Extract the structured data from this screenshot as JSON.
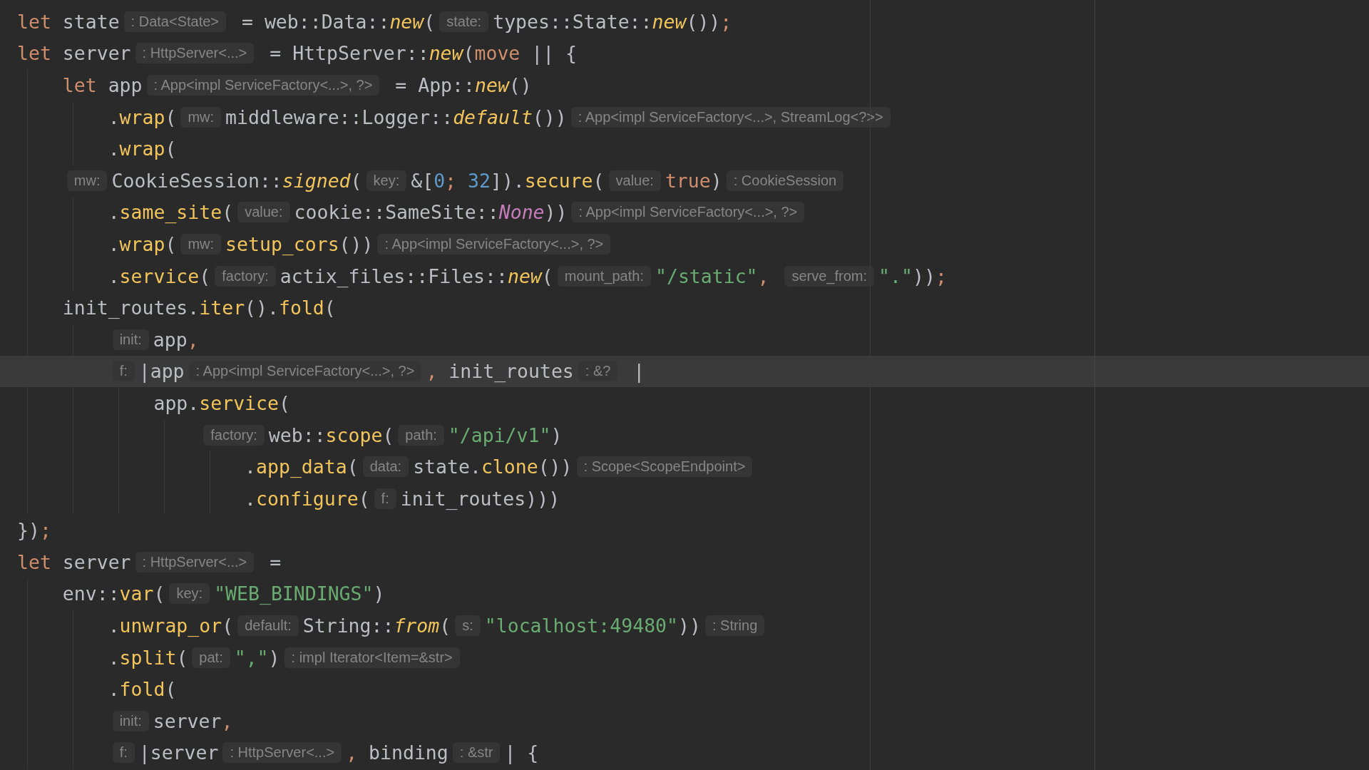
{
  "lines": [
    {
      "current": false,
      "tokens": [
        {
          "kind": "kw",
          "text": "let"
        },
        {
          "kind": "id",
          "text": " state"
        },
        {
          "kind": "hint",
          "text": ": Data<State>"
        },
        {
          "kind": "id",
          "text": " = web::Data::"
        },
        {
          "kind": "fni",
          "text": "new"
        },
        {
          "kind": "id",
          "text": "("
        },
        {
          "kind": "hint",
          "text": "state:"
        },
        {
          "kind": "id",
          "text": "types::State::"
        },
        {
          "kind": "fni",
          "text": "new"
        },
        {
          "kind": "id",
          "text": "())"
        },
        {
          "kind": "op",
          "text": ";"
        }
      ]
    },
    {
      "current": false,
      "tokens": [
        {
          "kind": "kw",
          "text": "let"
        },
        {
          "kind": "id",
          "text": " server"
        },
        {
          "kind": "hint",
          "text": ": HttpServer<...>"
        },
        {
          "kind": "id",
          "text": " = HttpServer::"
        },
        {
          "kind": "fni",
          "text": "new"
        },
        {
          "kind": "id",
          "text": "("
        },
        {
          "kind": "kw",
          "text": "move"
        },
        {
          "kind": "id",
          "text": " || {"
        }
      ],
      "children": [
        {
          "current": false,
          "tokens": [
            {
              "kind": "kw",
              "text": "let"
            },
            {
              "kind": "id",
              "text": " app"
            },
            {
              "kind": "hint",
              "text": ": App<impl ServiceFactory<...>, ?>"
            },
            {
              "kind": "id",
              "text": " = App::"
            },
            {
              "kind": "fni",
              "text": "new"
            },
            {
              "kind": "id",
              "text": "()"
            }
          ],
          "children": [
            {
              "current": false,
              "tokens": [
                {
                  "kind": "method",
                  "text": ".wrap"
                },
                {
                  "kind": "id",
                  "text": "("
                },
                {
                  "kind": "hint",
                  "text": "mw:"
                },
                {
                  "kind": "id",
                  "text": "middleware::Logger::"
                },
                {
                  "kind": "fni",
                  "text": "default"
                },
                {
                  "kind": "id",
                  "text": "())"
                },
                {
                  "kind": "hint",
                  "text": ": App<impl ServiceFactory<...>, StreamLog<?>>"
                }
              ]
            },
            {
              "current": false,
              "tokens": [
                {
                  "kind": "method",
                  "text": ".wrap"
                },
                {
                  "kind": "id",
                  "text": "("
                }
              ]
            }
          ]
        },
        {
          "current": false,
          "tokens": [
            {
              "kind": "hint",
              "text": "mw:"
            },
            {
              "kind": "id",
              "text": "CookieSession::"
            },
            {
              "kind": "fni",
              "text": "signed"
            },
            {
              "kind": "id",
              "text": "("
            },
            {
              "kind": "hint",
              "text": "key:"
            },
            {
              "kind": "id",
              "text": "&["
            },
            {
              "kind": "num",
              "text": "0"
            },
            {
              "kind": "op",
              "text": ";"
            },
            {
              "kind": "num",
              "text": " 32"
            },
            {
              "kind": "id",
              "text": "])"
            },
            {
              "kind": "method",
              "text": ".secure"
            },
            {
              "kind": "id",
              "text": "("
            },
            {
              "kind": "hint",
              "text": "value:"
            },
            {
              "kind": "kw",
              "text": "true"
            },
            {
              "kind": "id",
              "text": ")"
            },
            {
              "kind": "hint",
              "text": ": CookieSession"
            }
          ],
          "children": [
            {
              "current": false,
              "tokens": [
                {
                  "kind": "method",
                  "text": ".same_site"
                },
                {
                  "kind": "id",
                  "text": "("
                },
                {
                  "kind": "hint",
                  "text": "value:"
                },
                {
                  "kind": "id",
                  "text": "cookie::SameSite::"
                },
                {
                  "kind": "enum",
                  "text": "None"
                },
                {
                  "kind": "id",
                  "text": "))"
                },
                {
                  "kind": "hint",
                  "text": ": App<impl ServiceFactory<...>, ?>"
                }
              ]
            },
            {
              "current": false,
              "tokens": [
                {
                  "kind": "method",
                  "text": ".wrap"
                },
                {
                  "kind": "id",
                  "text": "("
                },
                {
                  "kind": "hint",
                  "text": "mw:"
                },
                {
                  "kind": "fn",
                  "text": "setup_cors"
                },
                {
                  "kind": "id",
                  "text": "())"
                },
                {
                  "kind": "hint",
                  "text": ": App<impl ServiceFactory<...>, ?>"
                }
              ]
            },
            {
              "current": false,
              "tokens": [
                {
                  "kind": "method",
                  "text": ".service"
                },
                {
                  "kind": "id",
                  "text": "("
                },
                {
                  "kind": "hint",
                  "text": "factory:"
                },
                {
                  "kind": "id",
                  "text": "actix_files::Files::"
                },
                {
                  "kind": "fni",
                  "text": "new"
                },
                {
                  "kind": "id",
                  "text": "("
                },
                {
                  "kind": "hint",
                  "text": "mount_path:"
                },
                {
                  "kind": "str",
                  "text": "\"/static\""
                },
                {
                  "kind": "op",
                  "text": ", "
                },
                {
                  "kind": "hint",
                  "text": "serve_from:"
                },
                {
                  "kind": "str",
                  "text": "\".\""
                },
                {
                  "kind": "id",
                  "text": "))"
                },
                {
                  "kind": "op",
                  "text": ";"
                }
              ]
            }
          ]
        },
        {
          "current": false,
          "tokens": [
            {
              "kind": "id",
              "text": "init_routes"
            },
            {
              "kind": "method",
              "text": ".iter"
            },
            {
              "kind": "id",
              "text": "()"
            },
            {
              "kind": "method",
              "text": ".fold"
            },
            {
              "kind": "id",
              "text": "("
            }
          ],
          "children": [
            {
              "current": false,
              "tokens": [
                {
                  "kind": "hint",
                  "text": "init:"
                },
                {
                  "kind": "id",
                  "text": "app"
                },
                {
                  "kind": "op",
                  "text": ","
                }
              ]
            },
            {
              "current": true,
              "tokens": [
                {
                  "kind": "hint",
                  "text": "f:"
                },
                {
                  "kind": "id",
                  "text": "|app"
                },
                {
                  "kind": "hint",
                  "text": ": App<impl ServiceFactory<...>, ?>"
                },
                {
                  "kind": "op",
                  "text": ","
                },
                {
                  "kind": "id",
                  "text": " init_routes"
                },
                {
                  "kind": "hint",
                  "text": ": &?"
                },
                {
                  "kind": "id",
                  "text": " |"
                }
              ],
              "children": [
                {
                  "current": false,
                  "tokens": [
                    {
                      "kind": "id",
                      "text": "app"
                    },
                    {
                      "kind": "method",
                      "text": ".service"
                    },
                    {
                      "kind": "id",
                      "text": "("
                    }
                  ],
                  "children": [
                    {
                      "current": false,
                      "tokens": [
                        {
                          "kind": "hint",
                          "text": "factory:"
                        },
                        {
                          "kind": "id",
                          "text": "web::"
                        },
                        {
                          "kind": "fn",
                          "text": "scope"
                        },
                        {
                          "kind": "id",
                          "text": "("
                        },
                        {
                          "kind": "hint",
                          "text": "path:"
                        },
                        {
                          "kind": "str",
                          "text": "\"/api/v1\""
                        },
                        {
                          "kind": "id",
                          "text": ")"
                        }
                      ],
                      "children": [
                        {
                          "current": false,
                          "tokens": [
                            {
                              "kind": "method",
                              "text": ".app_data"
                            },
                            {
                              "kind": "id",
                              "text": "("
                            },
                            {
                              "kind": "hint",
                              "text": "data:"
                            },
                            {
                              "kind": "id",
                              "text": "state"
                            },
                            {
                              "kind": "method",
                              "text": ".clone"
                            },
                            {
                              "kind": "id",
                              "text": "())"
                            },
                            {
                              "kind": "hint",
                              "text": ": Scope<ScopeEndpoint>"
                            }
                          ]
                        },
                        {
                          "current": false,
                          "tokens": [
                            {
                              "kind": "method",
                              "text": ".configure"
                            },
                            {
                              "kind": "id",
                              "text": "("
                            },
                            {
                              "kind": "hint",
                              "text": "f:"
                            },
                            {
                              "kind": "id",
                              "text": "init_routes)))"
                            }
                          ]
                        }
                      ]
                    }
                  ]
                }
              ]
            }
          ]
        }
      ]
    },
    {
      "current": false,
      "tokens": [
        {
          "kind": "id",
          "text": "})"
        },
        {
          "kind": "op",
          "text": ";"
        }
      ]
    },
    {
      "current": false,
      "tokens": [
        {
          "kind": "kw",
          "text": "let"
        },
        {
          "kind": "id",
          "text": " server"
        },
        {
          "kind": "hint",
          "text": ": HttpServer<...>"
        },
        {
          "kind": "id",
          "text": " ="
        }
      ],
      "children": [
        {
          "current": false,
          "tokens": [
            {
              "kind": "id",
              "text": "env::"
            },
            {
              "kind": "fn",
              "text": "var"
            },
            {
              "kind": "id",
              "text": "("
            },
            {
              "kind": "hint",
              "text": "key:"
            },
            {
              "kind": "str",
              "text": "\"WEB_BINDINGS\""
            },
            {
              "kind": "id",
              "text": ")"
            }
          ],
          "children": [
            {
              "current": false,
              "tokens": [
                {
                  "kind": "method",
                  "text": ".unwrap_or"
                },
                {
                  "kind": "id",
                  "text": "("
                },
                {
                  "kind": "hint",
                  "text": "default:"
                },
                {
                  "kind": "id",
                  "text": "String::"
                },
                {
                  "kind": "fni",
                  "text": "from"
                },
                {
                  "kind": "id",
                  "text": "("
                },
                {
                  "kind": "hint",
                  "text": "s:"
                },
                {
                  "kind": "str",
                  "text": "\"localhost:49480\""
                },
                {
                  "kind": "id",
                  "text": "))"
                },
                {
                  "kind": "hint",
                  "text": ": String"
                }
              ]
            },
            {
              "current": false,
              "tokens": [
                {
                  "kind": "method",
                  "text": ".split"
                },
                {
                  "kind": "id",
                  "text": "("
                },
                {
                  "kind": "hint",
                  "text": "pat:"
                },
                {
                  "kind": "str",
                  "text": "\",\""
                },
                {
                  "kind": "id",
                  "text": ")"
                },
                {
                  "kind": "hint",
                  "text": ": impl Iterator<Item=&str>"
                }
              ]
            },
            {
              "current": false,
              "tokens": [
                {
                  "kind": "method",
                  "text": ".fold"
                },
                {
                  "kind": "id",
                  "text": "("
                }
              ]
            },
            {
              "current": false,
              "tokens": [
                {
                  "kind": "hint",
                  "text": "init:"
                },
                {
                  "kind": "id",
                  "text": "server"
                },
                {
                  "kind": "op",
                  "text": ","
                }
              ]
            },
            {
              "current": false,
              "tokens": [
                {
                  "kind": "hint",
                  "text": "f:"
                },
                {
                  "kind": "id",
                  "text": "|server"
                },
                {
                  "kind": "hint",
                  "text": ": HttpServer<...>"
                },
                {
                  "kind": "op",
                  "text": ","
                },
                {
                  "kind": "id",
                  "text": " binding"
                },
                {
                  "kind": "hint",
                  "text": ": &str"
                },
                {
                  "kind": "id",
                  "text": "| {"
                }
              ]
            }
          ]
        }
      ]
    }
  ]
}
